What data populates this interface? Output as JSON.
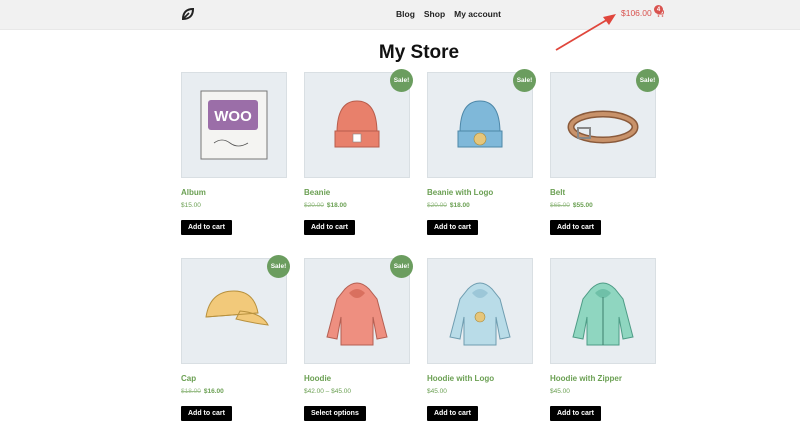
{
  "header": {
    "logo_icon": "leaf-logo-icon",
    "nav": [
      "Blog",
      "Shop",
      "My account"
    ],
    "cart": {
      "total": "$106.00",
      "count": "4",
      "icon": "cart-icon",
      "color": "#d9534f"
    }
  },
  "page": {
    "title": "My Store"
  },
  "products": [
    {
      "name": "Album",
      "price": "$15.00",
      "old_price": "",
      "sale_price": "",
      "sale_badge": "",
      "button": "Add to cart",
      "image": "album-image"
    },
    {
      "name": "Beanie",
      "price": "",
      "old_price": "$20.00",
      "sale_price": "$18.00",
      "sale_badge": "Sale!",
      "button": "Add to cart",
      "image": "beanie-image"
    },
    {
      "name": "Beanie with Logo",
      "price": "",
      "old_price": "$20.00",
      "sale_price": "$18.00",
      "sale_badge": "Sale!",
      "button": "Add to cart",
      "image": "beanie-logo-image"
    },
    {
      "name": "Belt",
      "price": "",
      "old_price": "$65.00",
      "sale_price": "$55.00",
      "sale_badge": "Sale!",
      "button": "Add to cart",
      "image": "belt-image"
    },
    {
      "name": "Cap",
      "price": "",
      "old_price": "$18.00",
      "sale_price": "$16.00",
      "sale_badge": "Sale!",
      "button": "Add to cart",
      "image": "cap-image"
    },
    {
      "name": "Hoodie",
      "price": "$42.00 – $45.00",
      "old_price": "",
      "sale_price": "",
      "sale_badge": "Sale!",
      "button": "Select options",
      "image": "hoodie-image"
    },
    {
      "name": "Hoodie with Logo",
      "price": "$45.00",
      "old_price": "",
      "sale_price": "",
      "sale_badge": "",
      "button": "Add to cart",
      "image": "hoodie-logo-image"
    },
    {
      "name": "Hoodie with Zipper",
      "price": "$45.00",
      "old_price": "",
      "sale_price": "",
      "sale_badge": "",
      "button": "Add to cart",
      "image": "hoodie-zipper-image"
    }
  ],
  "colors": {
    "accent_green": "#6ba053",
    "sale_badge": "#6b9d5f",
    "annotation_arrow": "#e0463c"
  }
}
